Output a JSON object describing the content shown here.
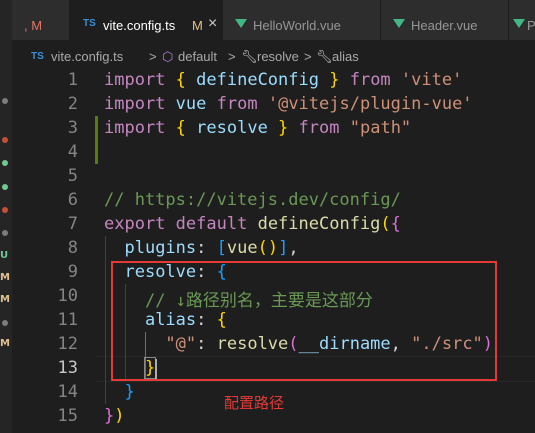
{
  "left_tab": {
    "label": ", M"
  },
  "tabs": [
    {
      "name": "vite.config.ts",
      "modified": "M",
      "close": "×",
      "type": "ts",
      "type_label": "TS",
      "active": true
    },
    {
      "name": "HelloWorld.vue",
      "type": "vue",
      "active": false
    },
    {
      "name": "Header.vue",
      "type": "vue",
      "active": false
    },
    {
      "name": "Pa",
      "type": "vue",
      "active": false
    }
  ],
  "breadcrumbs": {
    "file_badge": "TS",
    "file": "vite.config.ts",
    "sep": ">",
    "item2": "default",
    "item3": "resolve",
    "item4": "alias"
  },
  "sidebar_marks": [
    "U",
    "M",
    "M",
    "M"
  ],
  "line_numbers": [
    "1",
    "2",
    "3",
    "4",
    "5",
    "6",
    "7",
    "8",
    "9",
    "10",
    "11",
    "12",
    "13",
    "14",
    "15"
  ],
  "code": {
    "l1": {
      "k1": "import",
      "b": "{",
      "name": " defineConfig ",
      "b2": "}",
      "k2": "from",
      "s": "'vite'"
    },
    "l2": {
      "k1": "import",
      "name": "vue",
      "k2": "from",
      "s": "'@vitejs/plugin-vue'"
    },
    "l3": {
      "k1": "import",
      "b": "{",
      "name": " resolve ",
      "b2": "}",
      "k2": "from",
      "s": "\"path\""
    },
    "l6": {
      "c": "// https://vitejs.dev/config/"
    },
    "l7": {
      "k1": "export",
      "k2": "default",
      "fn": "defineConfig",
      "p": "(",
      "b": "{"
    },
    "l8": {
      "key": "plugins",
      "colon": ": ",
      "br": "[",
      "fn": "vue",
      "p": "()",
      "br2": "]",
      "comma": ","
    },
    "l9": {
      "key": "resolve",
      "colon": ": ",
      "b": "{"
    },
    "l10": {
      "c": "// ↓路径别名，主要是这部分"
    },
    "l11": {
      "key": "alias",
      "colon": ": ",
      "b": "{"
    },
    "l12": {
      "s1": "\"@\"",
      "colon": ": ",
      "fn": "resolve",
      "p": "(",
      "var": "__dirname",
      "comma": ", ",
      "s2": "\"./src\"",
      "p2": ")"
    },
    "l13": {
      "b": "}"
    },
    "l14": {
      "b": "}"
    },
    "l15": {
      "b": "}",
      "p": ")"
    }
  },
  "annotation": "配置路径",
  "colors": {
    "highlight_box": "#e53935",
    "keyword": "#569cd6",
    "string": "#ce9178"
  }
}
